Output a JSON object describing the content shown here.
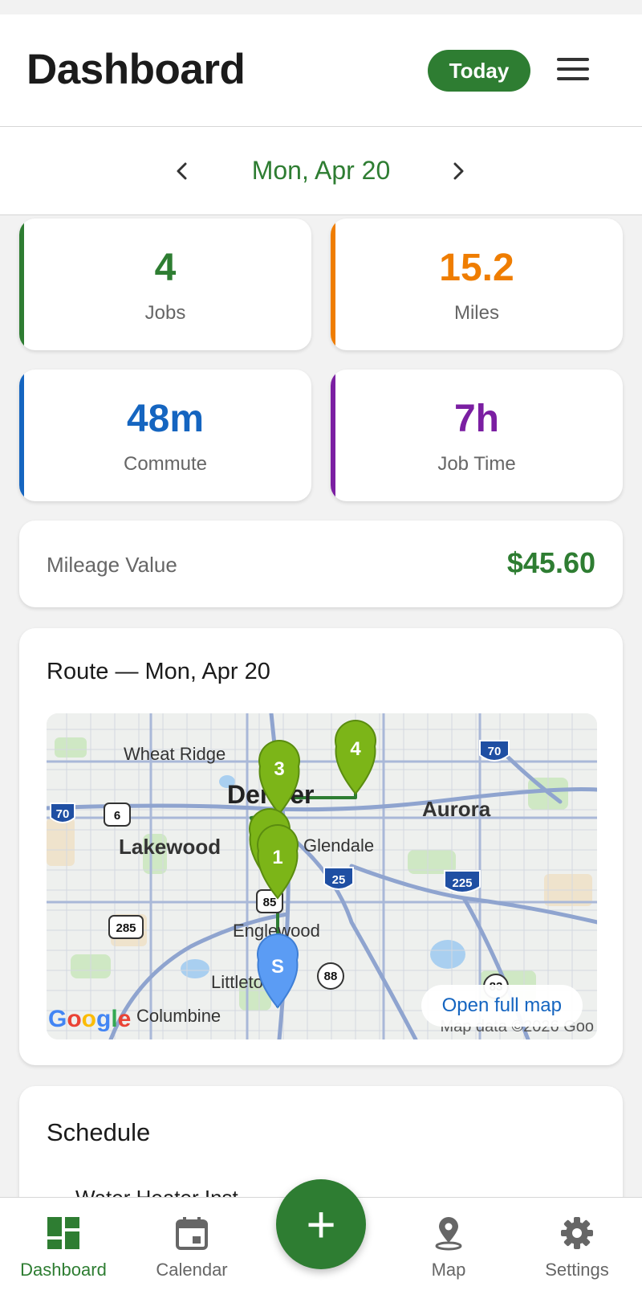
{
  "header": {
    "title": "Dashboard",
    "today_label": "Today"
  },
  "datebar": {
    "date": "Mon, Apr 20"
  },
  "stats": [
    {
      "value": "4",
      "label": "Jobs",
      "color": "#2e7d32"
    },
    {
      "value": "15.2",
      "label": "Miles",
      "color": "#ef7d00"
    },
    {
      "value": "48m",
      "label": "Commute",
      "color": "#1565c0"
    },
    {
      "value": "7h",
      "label": "Job Time",
      "color": "#7b1fa2"
    }
  ],
  "mileage": {
    "label": "Mileage Value",
    "value": "$45.60"
  },
  "route": {
    "title": "Route — Mon, Apr 20",
    "open_map_label": "Open full map",
    "map_data_label": "Map data ©2026 Goo",
    "google_label": "Google",
    "places": [
      "Wheat Ridge",
      "Denver",
      "Aurora",
      "Lakewood",
      "Glendale",
      "Englewood",
      "Littleton",
      "Columbine"
    ],
    "shields": [
      "70",
      "6",
      "25",
      "225",
      "85",
      "285",
      "88",
      "70",
      "83"
    ],
    "pins": [
      {
        "label": "3",
        "color": "#7cb518"
      },
      {
        "label": "4",
        "color": "#7cb518"
      },
      {
        "label": "2",
        "color": "#7cb518"
      },
      {
        "label": "1",
        "color": "#7cb518"
      },
      {
        "label": "S",
        "color": "#5b9cf4"
      }
    ],
    "route_color": "#2e7d32"
  },
  "schedule": {
    "title": "Schedule",
    "first_item": "Water Heater Inst..."
  },
  "nav": {
    "items": [
      {
        "label": "Dashboard",
        "icon": "dashboard-icon"
      },
      {
        "label": "Calendar",
        "icon": "calendar-icon"
      },
      {
        "label": "Map",
        "icon": "map-pin-icon"
      },
      {
        "label": "Settings",
        "icon": "gear-icon"
      }
    ],
    "fab_label": "+"
  }
}
